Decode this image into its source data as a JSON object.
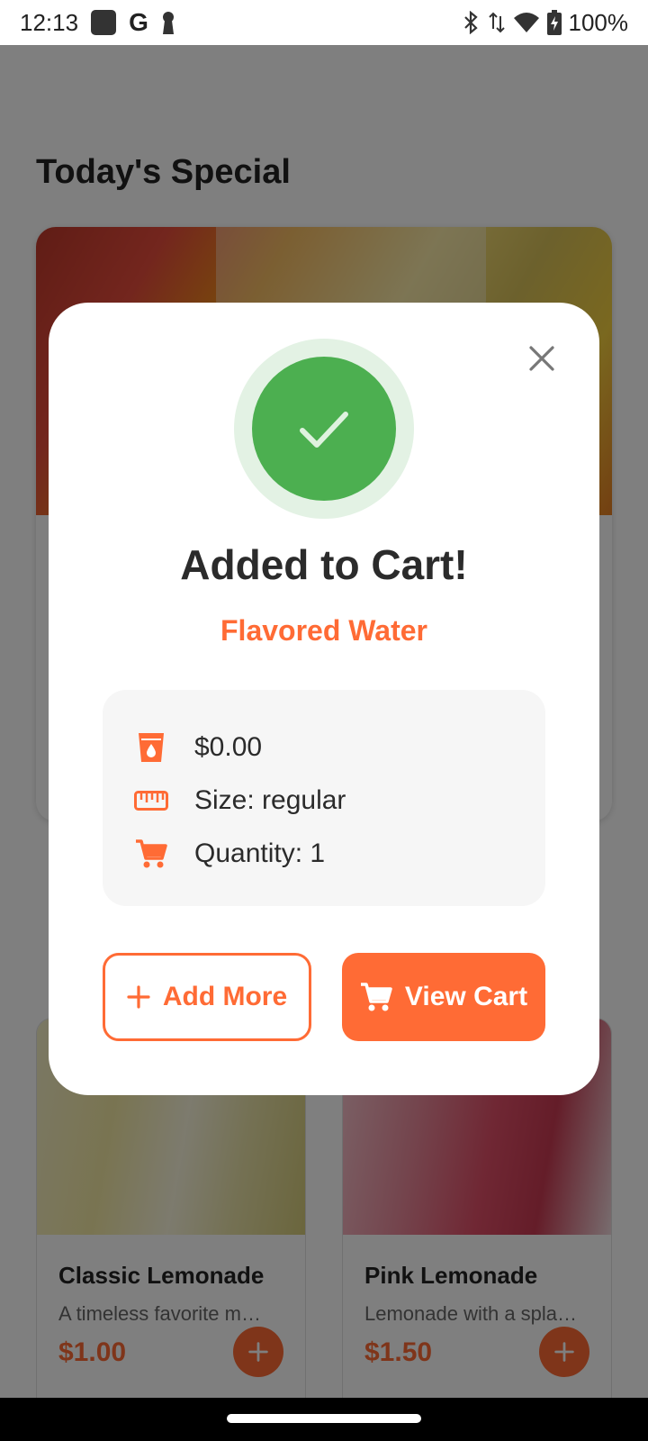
{
  "status_bar": {
    "time": "12:13",
    "battery": "100%"
  },
  "background": {
    "section_title": "Today's Special",
    "products": [
      {
        "name": "Classic Lemonade",
        "description": "A timeless favorite m…",
        "price": "$1.00"
      },
      {
        "name": "Pink Lemonade",
        "description": "Lemonade with a spla…",
        "price": "$1.50"
      }
    ]
  },
  "dialog": {
    "title": "Added to Cart!",
    "item_name": "Flavored Water",
    "price": "$0.00",
    "size": "Size: regular",
    "quantity": "Quantity: 1",
    "add_more_label": "Add More",
    "view_cart_label": "View Cart"
  },
  "colors": {
    "accent": "#ff6b35",
    "success": "#4caf50",
    "success_ring": "#e3f2e4"
  },
  "icons": [
    "check-icon",
    "close-icon",
    "cup-icon",
    "ruler-icon",
    "cart-icon",
    "plus-icon"
  ]
}
